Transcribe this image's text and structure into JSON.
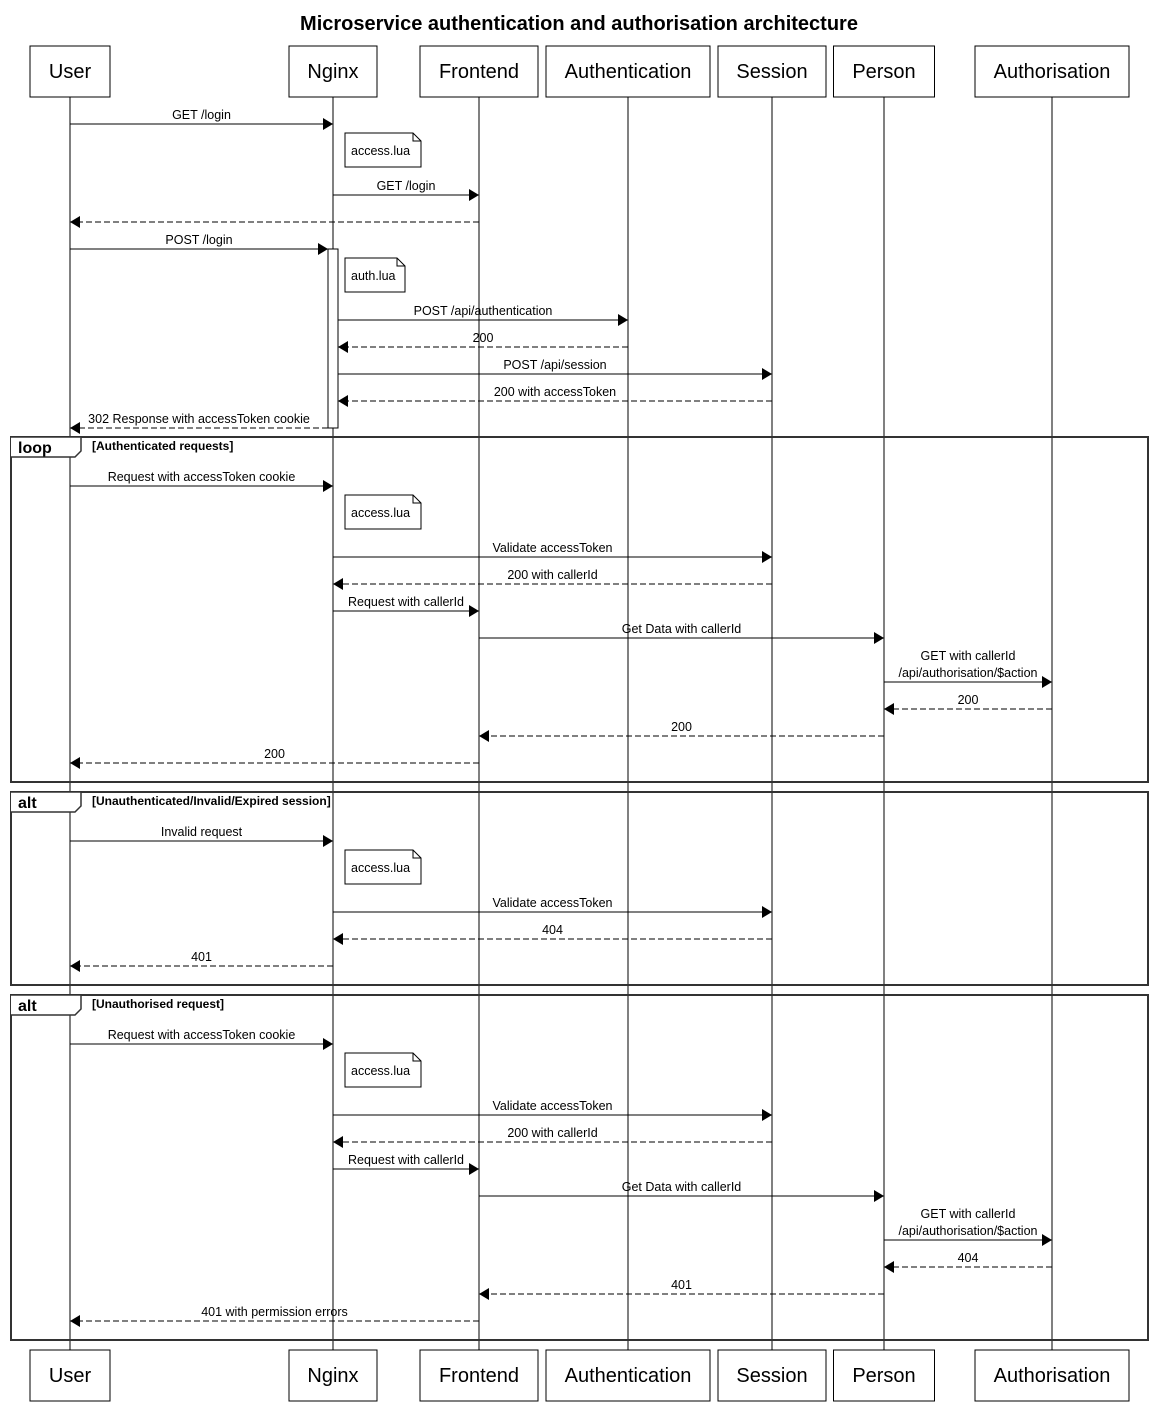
{
  "title": "Microservice authentication and authorisation architecture",
  "colors": {
    "line": "#000000",
    "frame": "#333333",
    "background": "#ffffff",
    "box_fill": "#ffffff"
  },
  "participants": [
    {
      "id": "user",
      "label": "User"
    },
    {
      "id": "nginx",
      "label": "Nginx"
    },
    {
      "id": "frontend",
      "label": "Frontend"
    },
    {
      "id": "authentication",
      "label": "Authentication"
    },
    {
      "id": "session",
      "label": "Session"
    },
    {
      "id": "person",
      "label": "Person"
    },
    {
      "id": "authorisation",
      "label": "Authorisation"
    }
  ],
  "steps": [
    {
      "kind": "message",
      "from": "user",
      "to": "nginx",
      "label": "GET /login",
      "style": "sync"
    },
    {
      "kind": "note",
      "over": "nginx",
      "label": "access.lua"
    },
    {
      "kind": "message",
      "from": "nginx",
      "to": "frontend",
      "label": "GET /login",
      "style": "sync"
    },
    {
      "kind": "message",
      "from": "frontend",
      "to": "user",
      "label": "",
      "style": "reply"
    },
    {
      "kind": "message",
      "from": "user",
      "to": "nginx",
      "label": "POST /login",
      "style": "sync",
      "activate": true
    },
    {
      "kind": "note",
      "over": "nginx",
      "label": "auth.lua"
    },
    {
      "kind": "message",
      "from": "nginx",
      "to": "authentication",
      "label": "POST /api/authentication",
      "style": "sync"
    },
    {
      "kind": "message",
      "from": "authentication",
      "to": "nginx",
      "label": "200",
      "style": "reply"
    },
    {
      "kind": "message",
      "from": "nginx",
      "to": "session",
      "label": "POST /api/session",
      "style": "sync"
    },
    {
      "kind": "message",
      "from": "session",
      "to": "nginx",
      "label": "200 with accessToken",
      "style": "reply"
    },
    {
      "kind": "message",
      "from": "nginx",
      "to": "user",
      "label": "302 Response with accessToken cookie",
      "style": "reply",
      "deactivate": true
    }
  ],
  "fragments": [
    {
      "operator": "loop",
      "guard": "[Authenticated requests]",
      "steps": [
        {
          "kind": "message",
          "from": "user",
          "to": "nginx",
          "label": "Request with accessToken cookie",
          "style": "sync"
        },
        {
          "kind": "note",
          "over": "nginx",
          "label": "access.lua"
        },
        {
          "kind": "message",
          "from": "nginx",
          "to": "session",
          "label": "Validate accessToken",
          "style": "sync"
        },
        {
          "kind": "message",
          "from": "session",
          "to": "nginx",
          "label": "200 with callerId",
          "style": "reply"
        },
        {
          "kind": "message",
          "from": "nginx",
          "to": "frontend",
          "label": "Request with callerId",
          "style": "sync"
        },
        {
          "kind": "message",
          "from": "frontend",
          "to": "person",
          "label": "Get Data with callerId",
          "style": "sync"
        },
        {
          "kind": "message",
          "from": "person",
          "to": "authorisation",
          "label": "GET with callerId\n/api/authorisation/$action",
          "style": "sync"
        },
        {
          "kind": "message",
          "from": "authorisation",
          "to": "person",
          "label": "200",
          "style": "reply"
        },
        {
          "kind": "message",
          "from": "person",
          "to": "frontend",
          "label": "200",
          "style": "reply"
        },
        {
          "kind": "message",
          "from": "frontend",
          "to": "user",
          "label": "200",
          "style": "reply"
        }
      ]
    },
    {
      "operator": "alt",
      "guard": "[Unauthenticated/Invalid/Expired session]",
      "steps": [
        {
          "kind": "message",
          "from": "user",
          "to": "nginx",
          "label": "Invalid request",
          "style": "sync"
        },
        {
          "kind": "note",
          "over": "nginx",
          "label": "access.lua"
        },
        {
          "kind": "message",
          "from": "nginx",
          "to": "session",
          "label": "Validate accessToken",
          "style": "sync"
        },
        {
          "kind": "message",
          "from": "session",
          "to": "nginx",
          "label": "404",
          "style": "reply"
        },
        {
          "kind": "message",
          "from": "nginx",
          "to": "user",
          "label": "401",
          "style": "reply"
        }
      ]
    },
    {
      "operator": "alt",
      "guard": "[Unauthorised request]",
      "steps": [
        {
          "kind": "message",
          "from": "user",
          "to": "nginx",
          "label": "Request with accessToken cookie",
          "style": "sync"
        },
        {
          "kind": "note",
          "over": "nginx",
          "label": "access.lua"
        },
        {
          "kind": "message",
          "from": "nginx",
          "to": "session",
          "label": "Validate accessToken",
          "style": "sync"
        },
        {
          "kind": "message",
          "from": "session",
          "to": "nginx",
          "label": "200 with callerId",
          "style": "reply"
        },
        {
          "kind": "message",
          "from": "nginx",
          "to": "frontend",
          "label": "Request with callerId",
          "style": "sync"
        },
        {
          "kind": "message",
          "from": "frontend",
          "to": "person",
          "label": "Get Data with callerId",
          "style": "sync"
        },
        {
          "kind": "message",
          "from": "person",
          "to": "authorisation",
          "label": "GET with callerId\n/api/authorisation/$action",
          "style": "sync"
        },
        {
          "kind": "message",
          "from": "authorisation",
          "to": "person",
          "label": "404",
          "style": "reply"
        },
        {
          "kind": "message",
          "from": "person",
          "to": "frontend",
          "label": "401",
          "style": "reply"
        },
        {
          "kind": "message",
          "from": "frontend",
          "to": "user",
          "label": "401 with permission errors",
          "style": "reply"
        }
      ]
    }
  ]
}
